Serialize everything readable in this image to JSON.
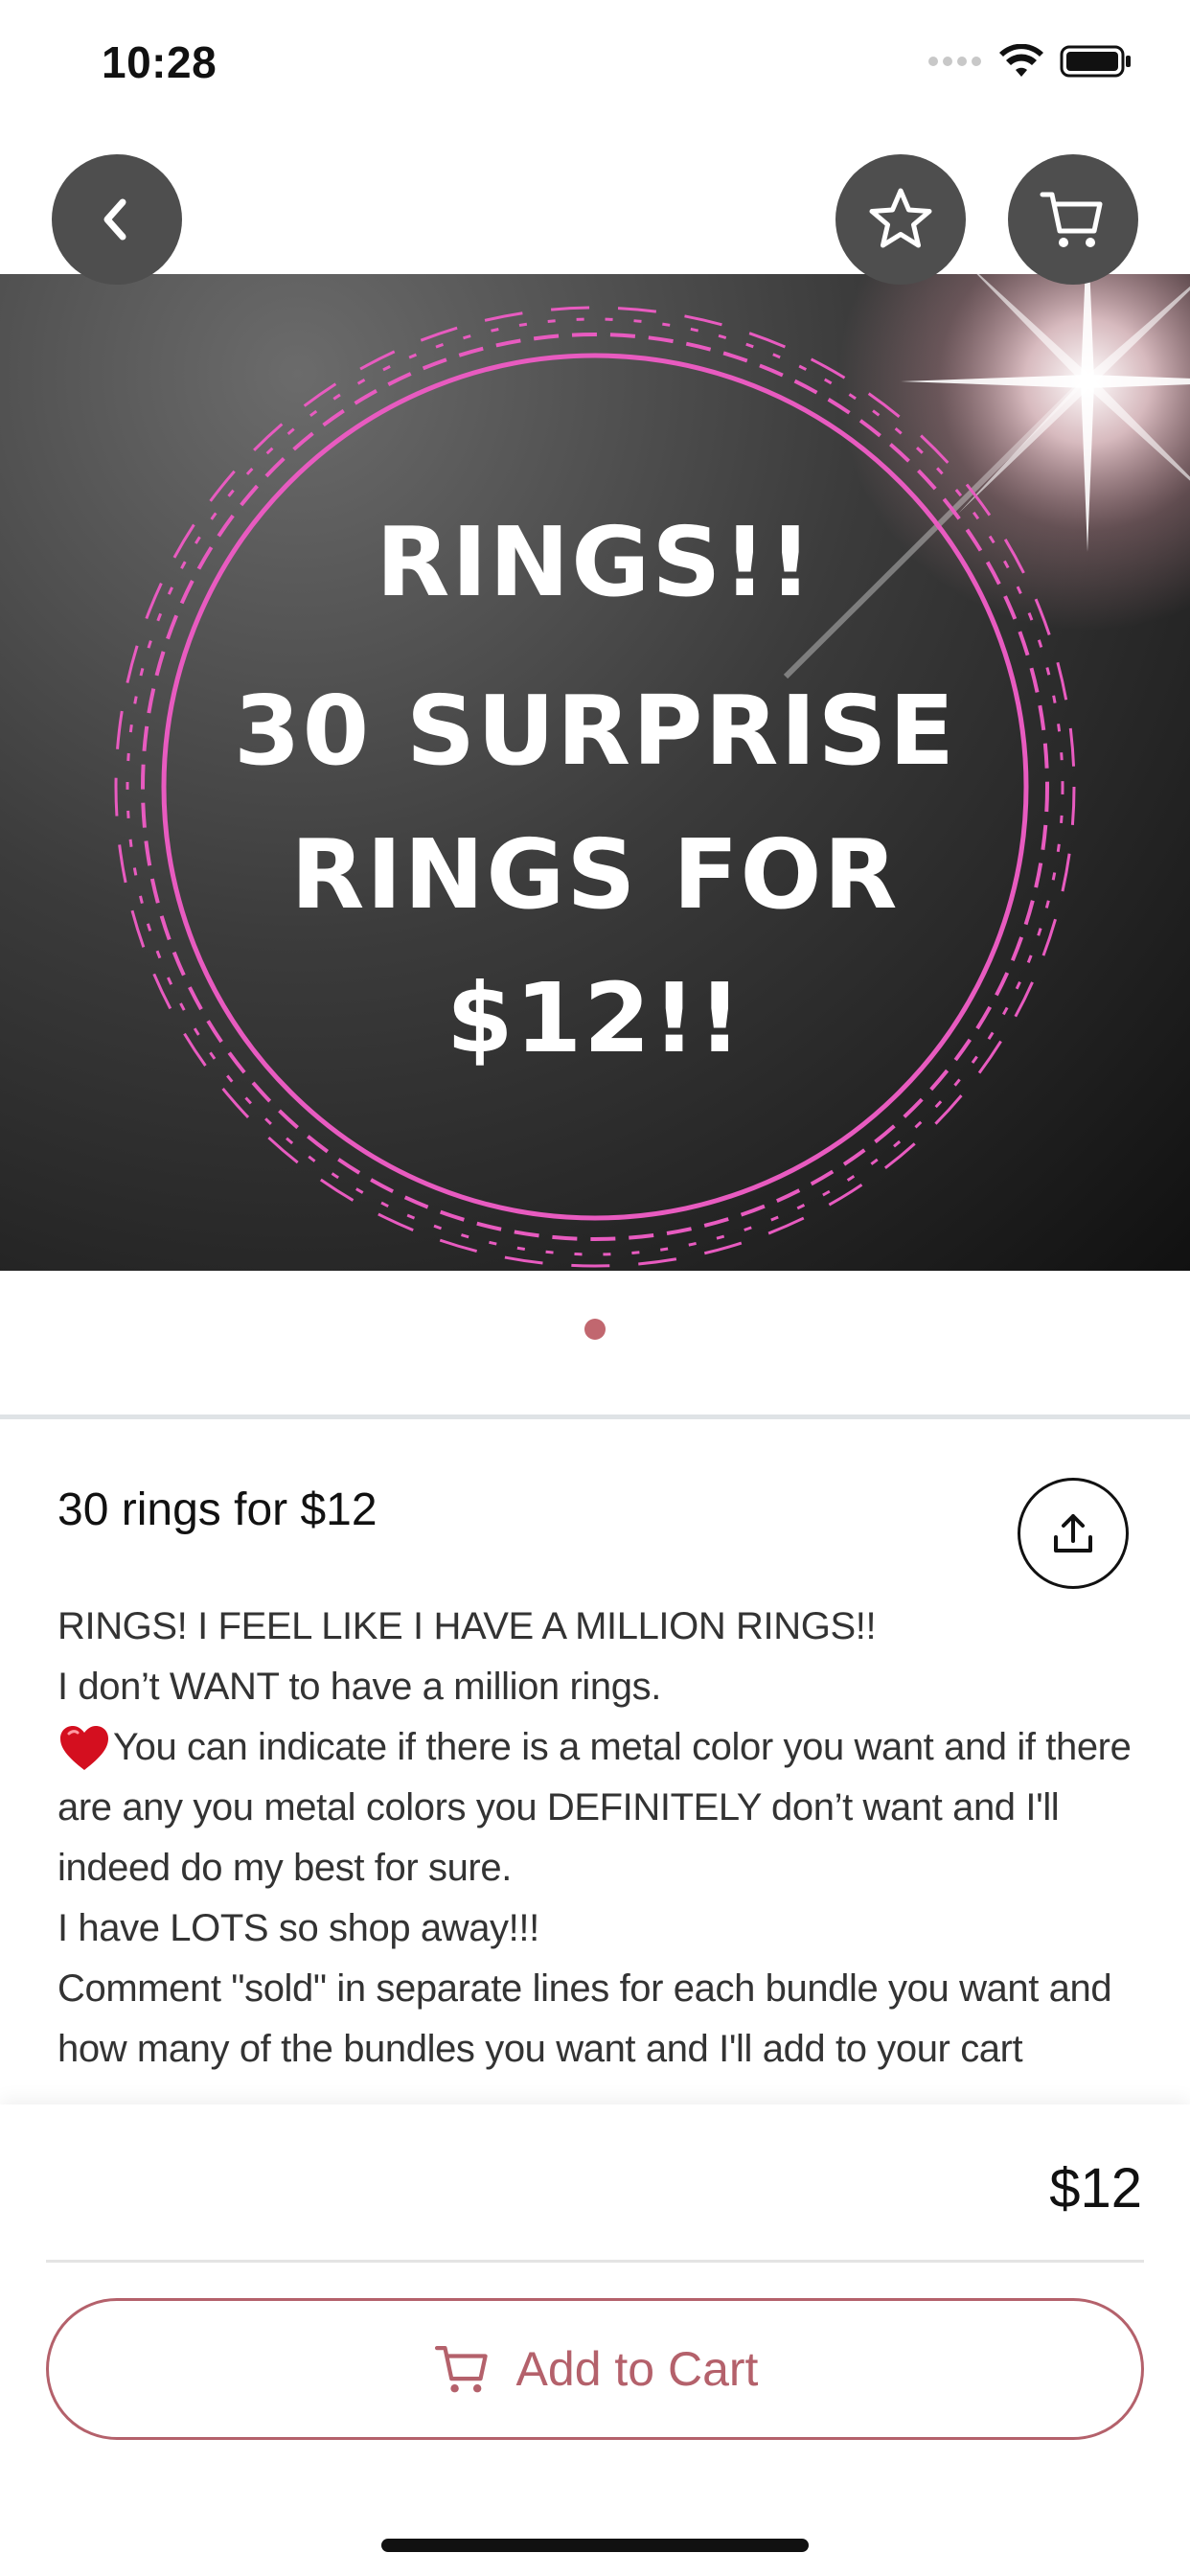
{
  "status_bar": {
    "time": "10:28"
  },
  "hero": {
    "lines": [
      "RINGS!!",
      "30 SURPRISE",
      "RINGS FOR",
      "$12!!"
    ],
    "image_count": 1,
    "active_index": 0
  },
  "listing": {
    "title": "30 rings for $12",
    "description": [
      "RINGS! I FEEL LIKE I HAVE A MILLION RINGS!!",
      "I don’t WANT to have a million rings.",
      "You can indicate if there is a metal color you want and if there are any you metal colors you DEFINITELY don’t want and I'll indeed do my best for sure.",
      "I have LOTS so shop away!!!",
      "Comment \"sold\" in separate lines for each bundle you want and how many of the bundles you want and I'll add to your cart"
    ],
    "price": "$12"
  },
  "actions": {
    "add_to_cart_label": "Add to Cart"
  },
  "icons": {
    "back": "chevron-left-icon",
    "favorite": "star-icon",
    "cart": "cart-icon",
    "share": "share-upload-icon",
    "heart": "heart-emoji-icon"
  },
  "colors": {
    "accent": "#b4616b",
    "nav_button_bg": "#4e4e4e",
    "frame_pink": "#e85bc0",
    "page_dot": "#c1676f"
  }
}
